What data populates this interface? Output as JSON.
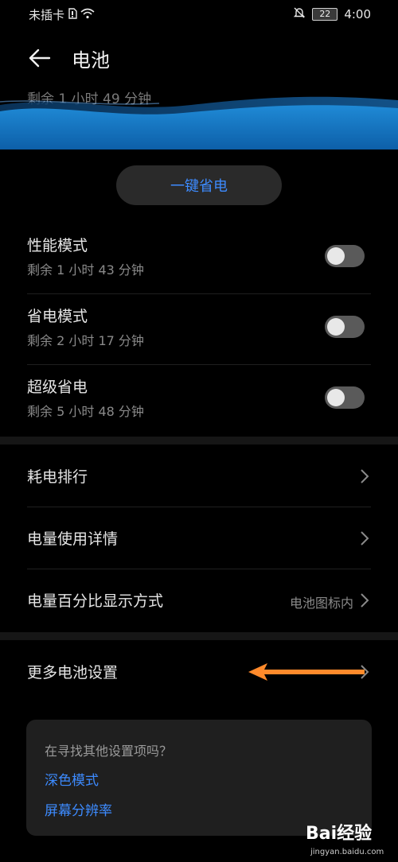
{
  "status_bar": {
    "carrier": "未插卡",
    "battery_level": "22",
    "time": "4:00",
    "icons": [
      "sim-icon",
      "wifi-icon",
      "mute-icon",
      "battery-icon"
    ]
  },
  "header": {
    "title": "电池",
    "back_icon": "back-arrow-icon"
  },
  "battery_wave": {
    "remaining": "剩余 1 小时 49 分钟"
  },
  "power_save_button": {
    "label": "一键省电"
  },
  "modes": [
    {
      "title": "性能模式",
      "subtitle": "剩余 1 小时 43 分钟",
      "enabled": false
    },
    {
      "title": "省电模式",
      "subtitle": "剩余 2 小时 17 分钟",
      "enabled": false
    },
    {
      "title": "超级省电",
      "subtitle": "剩余 5 小时 48 分钟",
      "enabled": false
    }
  ],
  "list": [
    {
      "label": "耗电排行",
      "value": ""
    },
    {
      "label": "电量使用详情",
      "value": ""
    },
    {
      "label": "电量百分比显示方式",
      "value": "电池图标内"
    }
  ],
  "more_settings": {
    "label": "更多电池设置"
  },
  "suggestions": {
    "question": "在寻找其他设置项吗？",
    "links": [
      "深色模式",
      "屏幕分辨率"
    ]
  },
  "watermark": {
    "logo": "Bai经验",
    "site": "jingyan.baidu.com"
  },
  "colors": {
    "accent": "#3d8bff",
    "annotation_arrow": "#ff8a2b",
    "background": "#000000"
  }
}
